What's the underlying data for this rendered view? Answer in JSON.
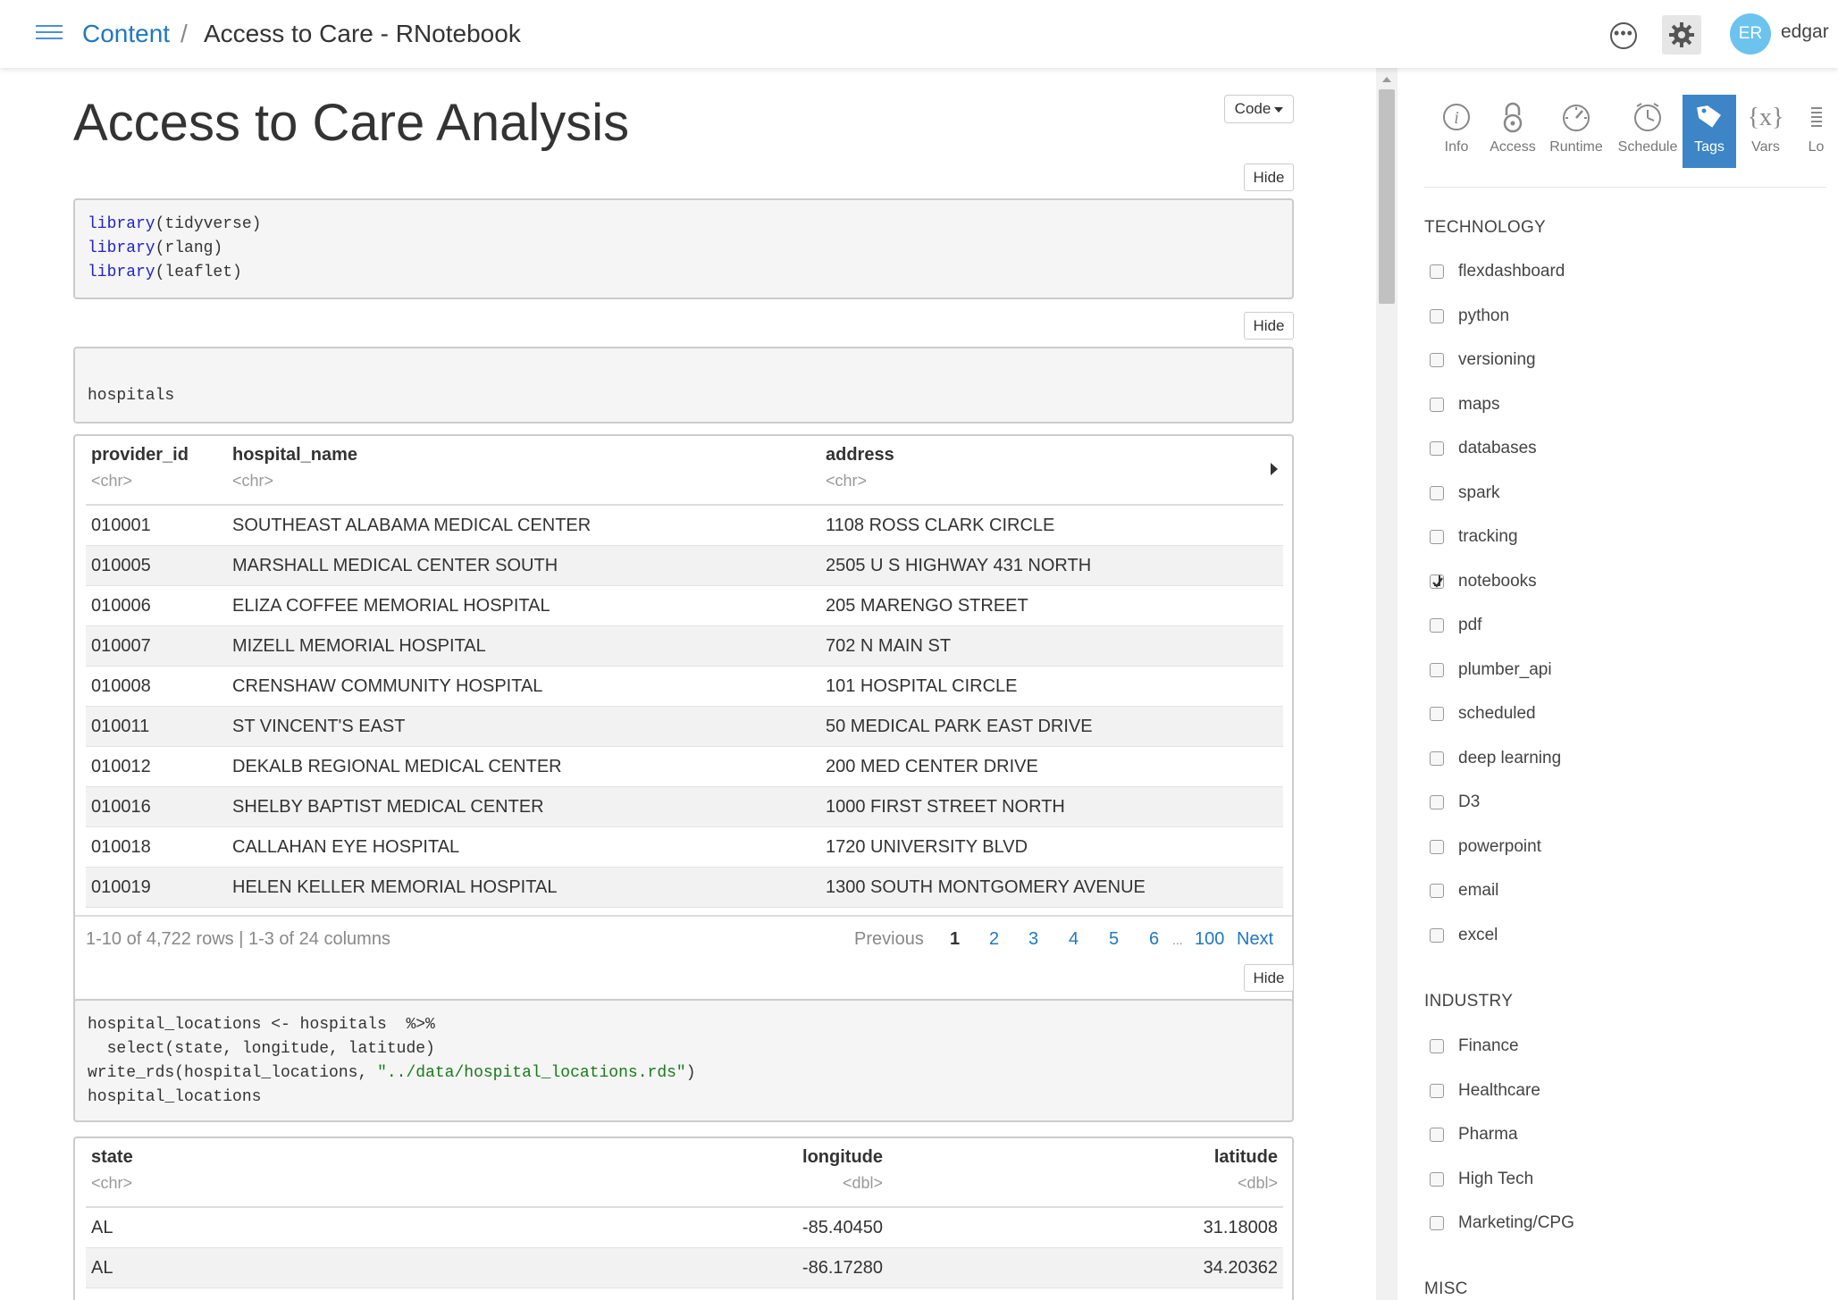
{
  "header": {
    "breadcrumb_root": "Content",
    "breadcrumb_sep": "/",
    "breadcrumb_title": "Access to Care - RNotebook",
    "avatar_initials": "ER",
    "username": "edgar"
  },
  "doc": {
    "title": "Access to Care Analysis",
    "code_menu_label": "Code",
    "hide_label": "Hide",
    "chunk1": {
      "lines": [
        {
          "fn": "library",
          "arg": "(tidyverse)"
        },
        {
          "fn": "library",
          "arg": "(rlang)"
        },
        {
          "fn": "library",
          "arg": "(leaflet)"
        }
      ]
    },
    "chunk2": {
      "code": "hospitals"
    },
    "table1": {
      "columns": [
        {
          "name": "provider_id",
          "type": "<chr>"
        },
        {
          "name": "hospital_name",
          "type": "<chr>"
        },
        {
          "name": "address",
          "type": "<chr>"
        }
      ],
      "rows": [
        [
          "010001",
          "SOUTHEAST ALABAMA MEDICAL CENTER",
          "1108 ROSS CLARK CIRCLE"
        ],
        [
          "010005",
          "MARSHALL MEDICAL CENTER SOUTH",
          "2505 U S HIGHWAY 431 NORTH"
        ],
        [
          "010006",
          "ELIZA COFFEE MEMORIAL HOSPITAL",
          "205 MARENGO STREET"
        ],
        [
          "010007",
          "MIZELL MEMORIAL HOSPITAL",
          "702 N MAIN ST"
        ],
        [
          "010008",
          "CRENSHAW COMMUNITY HOSPITAL",
          "101 HOSPITAL CIRCLE"
        ],
        [
          "010011",
          "ST VINCENT'S EAST",
          "50 MEDICAL PARK EAST DRIVE"
        ],
        [
          "010012",
          "DEKALB REGIONAL MEDICAL CENTER",
          "200 MED CENTER DRIVE"
        ],
        [
          "010016",
          "SHELBY BAPTIST MEDICAL CENTER",
          "1000 FIRST STREET NORTH"
        ],
        [
          "010018",
          "CALLAHAN EYE HOSPITAL",
          "1720 UNIVERSITY BLVD"
        ],
        [
          "010019",
          "HELEN KELLER MEMORIAL HOSPITAL",
          "1300 SOUTH MONTGOMERY AVENUE"
        ]
      ],
      "summary": "1-10 of 4,722 rows | 1-3 of 24 columns",
      "pager": {
        "previous": "Previous",
        "pages": [
          "1",
          "2",
          "3",
          "4",
          "5",
          "6"
        ],
        "ellipsis": "...",
        "last": "100",
        "next": "Next",
        "current": "1"
      }
    },
    "chunk3": {
      "line1": "hospital_locations <- hospitals  %>%",
      "line2": "  select(state, longitude, latitude)",
      "line3_pre": "write_rds(hospital_locations, ",
      "line3_str": "\"../data/hospital_locations.rds\"",
      "line3_post": ")",
      "line4": "hospital_locations"
    },
    "table2": {
      "columns": [
        {
          "name": "state",
          "type": "<chr>"
        },
        {
          "name": "longitude",
          "type": "<dbl>"
        },
        {
          "name": "latitude",
          "type": "<dbl>"
        }
      ],
      "rows": [
        [
          "AL",
          "-85.40450",
          "31.18008"
        ],
        [
          "AL",
          "-86.17280",
          "34.20362"
        ]
      ]
    }
  },
  "panel": {
    "tabs": [
      {
        "label": "Info",
        "icon": "info-icon"
      },
      {
        "label": "Access",
        "icon": "lock-icon"
      },
      {
        "label": "Runtime",
        "icon": "gauge-icon"
      },
      {
        "label": "Schedule",
        "icon": "clock-icon"
      },
      {
        "label": "Tags",
        "icon": "tag-icon"
      },
      {
        "label": "Vars",
        "icon": "variables-icon"
      },
      {
        "label": "Lo",
        "icon": "logs-icon"
      }
    ],
    "active_tab": "Tags",
    "technology_heading": "TECHNOLOGY",
    "technology": [
      {
        "label": "flexdashboard",
        "checked": false
      },
      {
        "label": "python",
        "checked": false
      },
      {
        "label": "versioning",
        "checked": false
      },
      {
        "label": "maps",
        "checked": false
      },
      {
        "label": "databases",
        "checked": false
      },
      {
        "label": "spark",
        "checked": false
      },
      {
        "label": "tracking",
        "checked": false
      },
      {
        "label": "notebooks",
        "checked": true
      },
      {
        "label": "pdf",
        "checked": false
      },
      {
        "label": "plumber_api",
        "checked": false
      },
      {
        "label": "scheduled",
        "checked": false
      },
      {
        "label": "deep learning",
        "checked": false
      },
      {
        "label": "D3",
        "checked": false
      },
      {
        "label": "powerpoint",
        "checked": false
      },
      {
        "label": "email",
        "checked": false
      },
      {
        "label": "excel",
        "checked": false
      }
    ],
    "industry_heading": "INDUSTRY",
    "industry": [
      {
        "label": "Finance",
        "checked": false
      },
      {
        "label": "Healthcare",
        "checked": false
      },
      {
        "label": "Pharma",
        "checked": false
      },
      {
        "label": "High Tech",
        "checked": false
      },
      {
        "label": "Marketing/CPG",
        "checked": false
      }
    ],
    "misc_heading": "MISC"
  },
  "colors": {
    "link": "#1f78c1",
    "active_tab": "#3d85c6",
    "avatar": "#6cc3ee"
  }
}
